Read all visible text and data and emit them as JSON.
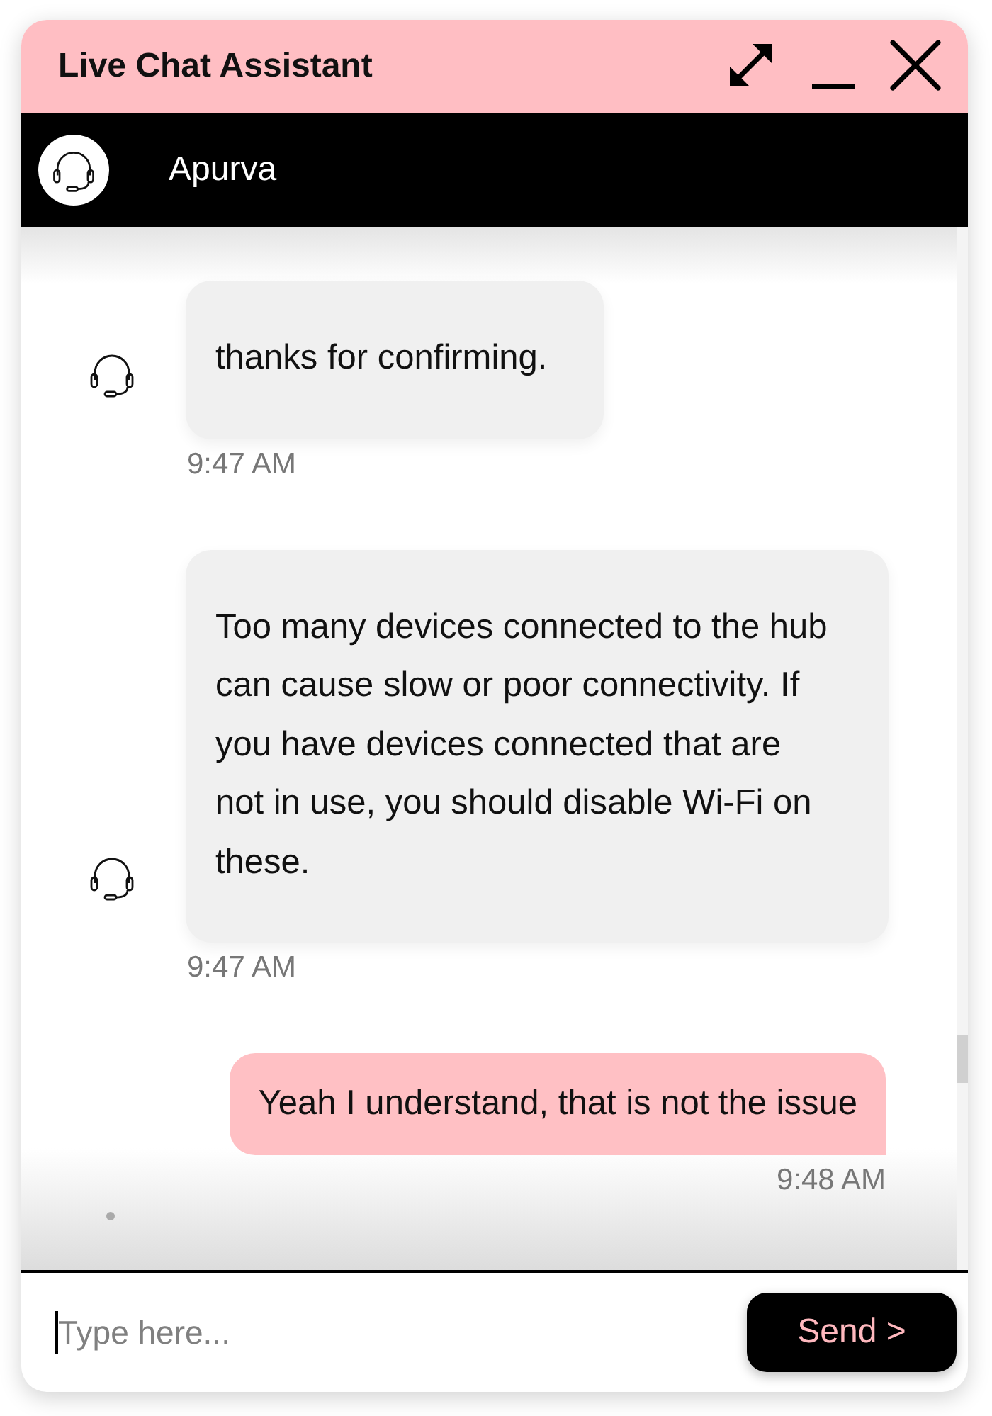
{
  "window": {
    "title": "Live Chat Assistant"
  },
  "agent": {
    "name": "Apurva"
  },
  "messages": [
    {
      "kind": "agent",
      "text": "thanks for confirming.",
      "time": "9:47 AM"
    },
    {
      "kind": "agent",
      "text": "Too many devices connected to the hub can cause slow or poor connectivity. If you have devices connected that are not in use, you should disable Wi-Fi on these.",
      "time": "9:47 AM"
    },
    {
      "kind": "user",
      "text": "Yeah I understand, that is not the issue",
      "time": "9:48 AM"
    }
  ],
  "composer": {
    "placeholder": "Type here...",
    "send_label": "Send >"
  }
}
